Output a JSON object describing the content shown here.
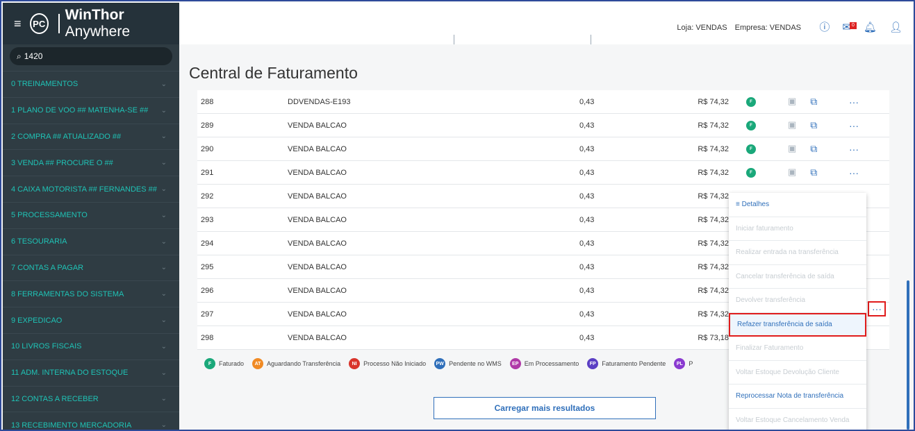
{
  "app": {
    "menu_icon": "≡",
    "logo_text": "PC",
    "name_bold": "WinThor",
    "name_light": "Anywhere"
  },
  "search": {
    "icon": "magnifier",
    "value": "1420"
  },
  "sidebar": {
    "items": [
      {
        "label": "0  TREINAMENTOS"
      },
      {
        "label": "1  PLANO DE VOO ## MATENHA-SE ##"
      },
      {
        "label": "2  COMPRA ## ATUALIZADO ##"
      },
      {
        "label": "3  VENDA ## PROCURE O ##"
      },
      {
        "label": "4  CAIXA MOTORISTA ## FERNANDES ##"
      },
      {
        "label": "5  PROCESSAMENTO"
      },
      {
        "label": "6  TESOURARIA"
      },
      {
        "label": "7  CONTAS A PAGAR"
      },
      {
        "label": "8  FERRAMENTAS DO SISTEMA"
      },
      {
        "label": "9  EXPEDICAO"
      },
      {
        "label": "10  LIVROS FISCAIS"
      },
      {
        "label": "11  ADM. INTERNA DO ESTOQUE"
      },
      {
        "label": "12  CONTAS A RECEBER"
      },
      {
        "label": "13  RECEBIMENTO MERCADORIA"
      }
    ]
  },
  "header": {
    "loja": "Loja: VENDAS",
    "empresa": "Empresa: VENDAS",
    "mail_badge": "0"
  },
  "main": {
    "title": "Central de Faturamento",
    "rows": [
      {
        "id": "288",
        "desc": "DDVENDAS-E193",
        "qty": "0,43",
        "value": "R$ 74,32",
        "status": "F"
      },
      {
        "id": "289",
        "desc": "VENDA BALCAO",
        "qty": "0,43",
        "value": "R$ 74,32",
        "status": "F"
      },
      {
        "id": "290",
        "desc": "VENDA BALCAO",
        "qty": "0,43",
        "value": "R$ 74,32",
        "status": "F"
      },
      {
        "id": "291",
        "desc": "VENDA BALCAO",
        "qty": "0,43",
        "value": "R$ 74,32",
        "status": "F"
      },
      {
        "id": "292",
        "desc": "VENDA BALCAO",
        "qty": "0,43",
        "value": "R$ 74,32",
        "status": ""
      },
      {
        "id": "293",
        "desc": "VENDA BALCAO",
        "qty": "0,43",
        "value": "R$ 74,32",
        "status": ""
      },
      {
        "id": "294",
        "desc": "VENDA BALCAO",
        "qty": "0,43",
        "value": "R$ 74,32",
        "status": ""
      },
      {
        "id": "295",
        "desc": "VENDA BALCAO",
        "qty": "0,43",
        "value": "R$ 74,32",
        "status": ""
      },
      {
        "id": "296",
        "desc": "VENDA BALCAO",
        "qty": "0,43",
        "value": "R$ 74,32",
        "status": ""
      },
      {
        "id": "297",
        "desc": "VENDA BALCAO",
        "qty": "0,43",
        "value": "R$ 74,32",
        "status": ""
      },
      {
        "id": "298",
        "desc": "VENDA BALCAO",
        "qty": "0,43",
        "value": "R$ 73,18",
        "status": ""
      }
    ],
    "more_label": "···",
    "legend": [
      {
        "badge": "F",
        "label": "Faturado",
        "color": "#1aa87a"
      },
      {
        "badge": "AT",
        "label": "Aguardando Transferência",
        "color": "#f08a24"
      },
      {
        "badge": "NI",
        "label": "Processo Não Iniciado",
        "color": "#d9342b"
      },
      {
        "badge": "PW",
        "label": "Pendente no WMS",
        "color": "#2f6fba"
      },
      {
        "badge": "EP",
        "label": "Em Processamento",
        "color": "#b03aa8"
      },
      {
        "badge": "FP",
        "label": "Faturamento Pendente",
        "color": "#5b3fc4"
      },
      {
        "badge": "PL",
        "label": "P",
        "color": "#8a3ad0"
      }
    ],
    "load_more": "Carregar mais resultados"
  },
  "context_menu": {
    "items": [
      {
        "label": "≡  Detalhes",
        "state": "active"
      },
      {
        "label": "Iniciar faturamento",
        "state": "disabled"
      },
      {
        "label": "Realizar entrada na transferência",
        "state": "disabled"
      },
      {
        "label": "Cancelar transferência de saída",
        "state": "disabled"
      },
      {
        "label": "Devolver transferência",
        "state": "disabled"
      },
      {
        "label": "Refazer transferência de saída",
        "state": "highlight"
      },
      {
        "label": "Finalizar Faturamento",
        "state": "disabled"
      },
      {
        "label": "Voltar Estoque Devolução Cliente",
        "state": "disabled"
      },
      {
        "label": "Reprocessar Nota de transferência",
        "state": "active"
      },
      {
        "label": "Voltar Estoque Cancelamento Venda",
        "state": "disabled"
      }
    ]
  },
  "colors": {
    "accent": "#2f6fba",
    "sidebar": "#2f3c43",
    "nav_text": "#1fc3b6",
    "faturado": "#1aa87a",
    "highlight": "#e01b1b"
  }
}
